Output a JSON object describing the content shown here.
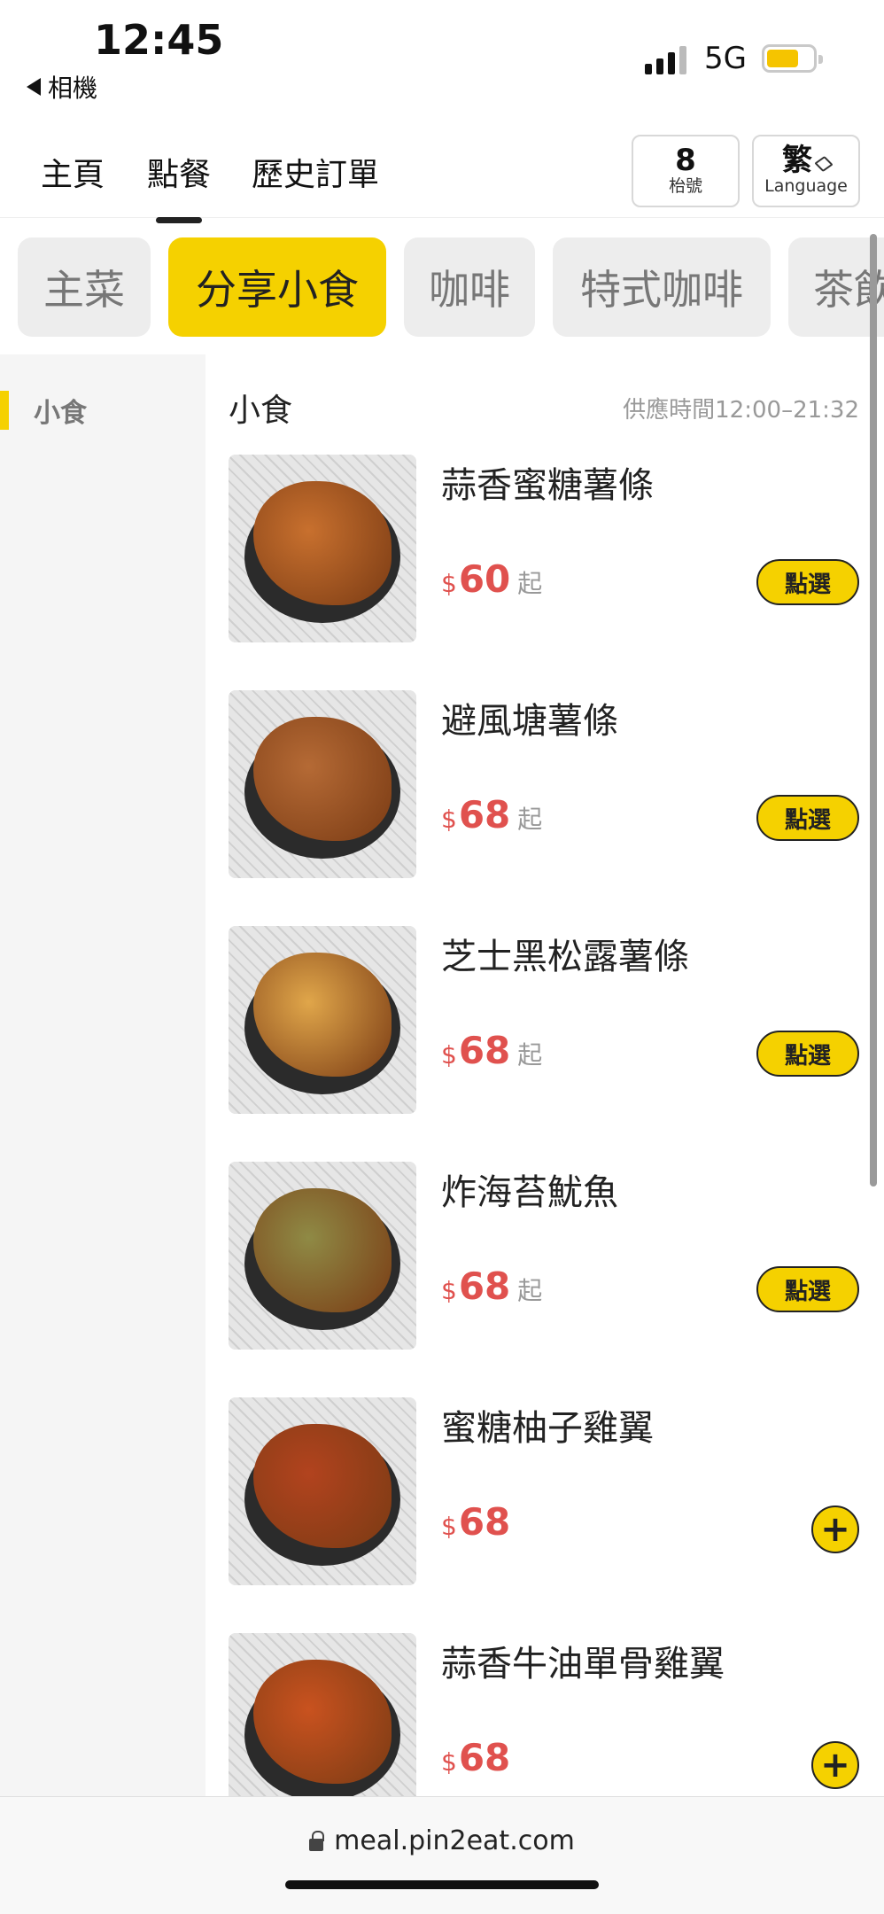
{
  "status_bar": {
    "time": "12:45",
    "back_label": "相機",
    "network": "5G",
    "battery_level": 0.7
  },
  "top_nav": {
    "tabs": [
      {
        "label": "主頁",
        "active": false
      },
      {
        "label": "點餐",
        "active": true
      },
      {
        "label": "歷史訂單",
        "active": false
      }
    ],
    "table_number": "8",
    "table_label": "枱號",
    "language_char": "繁",
    "language_label": "Language"
  },
  "categories": [
    {
      "label": "主菜",
      "active": false
    },
    {
      "label": "分享小食",
      "active": true
    },
    {
      "label": "咖啡",
      "active": false
    },
    {
      "label": "特式咖啡",
      "active": false
    },
    {
      "label": "茶飲",
      "active": false
    }
  ],
  "sidebar": {
    "items": [
      {
        "label": "小食",
        "active": true
      }
    ]
  },
  "section": {
    "title": "小食",
    "serving_time": "供應時間12:00–21:32"
  },
  "currency": "$",
  "from_label": "起",
  "select_label": "點選",
  "add_label": "+",
  "colors": {
    "accent": "#f5d100",
    "price": "#e0514e"
  },
  "menu_items": [
    {
      "name": "蒜香蜜糖薯條",
      "price": "60",
      "has_options": true
    },
    {
      "name": "避風塘薯條",
      "price": "68",
      "has_options": true
    },
    {
      "name": "芝士黑松露薯條",
      "price": "68",
      "has_options": true
    },
    {
      "name": "炸海苔魷魚",
      "price": "68",
      "has_options": true
    },
    {
      "name": "蜜糖柚子雞翼",
      "price": "68",
      "has_options": false
    },
    {
      "name": "蒜香牛油單骨雞翼",
      "price": "68",
      "has_options": false
    }
  ],
  "url_bar": {
    "url": "meal.pin2eat.com"
  }
}
